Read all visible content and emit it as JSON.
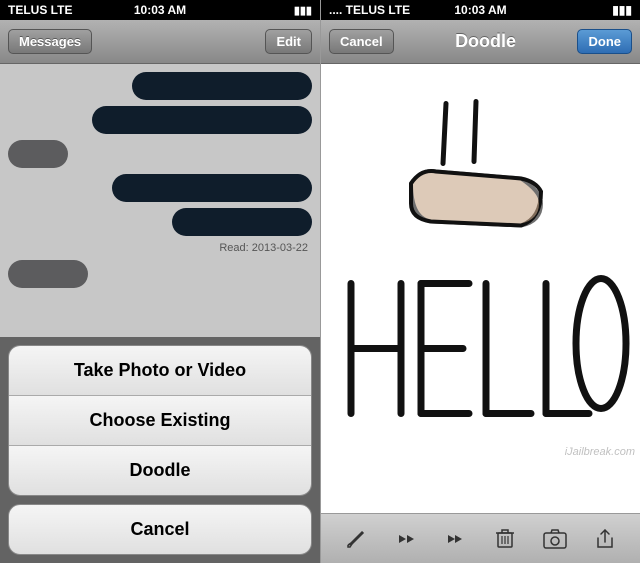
{
  "left": {
    "status_bar": {
      "carrier": "TELUS  LTE",
      "time": "10:03 AM",
      "battery": "⬜"
    },
    "nav": {
      "back_label": "Messages",
      "title": "",
      "edit_label": "Edit"
    },
    "messages": {
      "read_label": "Read: 2013-03-22"
    },
    "action_sheet": {
      "take_photo_label": "Take Photo or Video",
      "choose_existing_label": "Choose Existing",
      "doodle_label": "Doodle",
      "cancel_label": "Cancel"
    }
  },
  "right": {
    "status_bar": {
      "carrier": ".... TELUS  LTE",
      "time": "10:03 AM"
    },
    "nav": {
      "cancel_label": "Cancel",
      "title": "Doodle",
      "done_label": "Done"
    },
    "toolbar": {
      "icons": [
        "✏️",
        "⏮",
        "⏭",
        "🗑",
        "📷",
        "↗"
      ]
    },
    "watermark": "iJailbreak.com"
  }
}
